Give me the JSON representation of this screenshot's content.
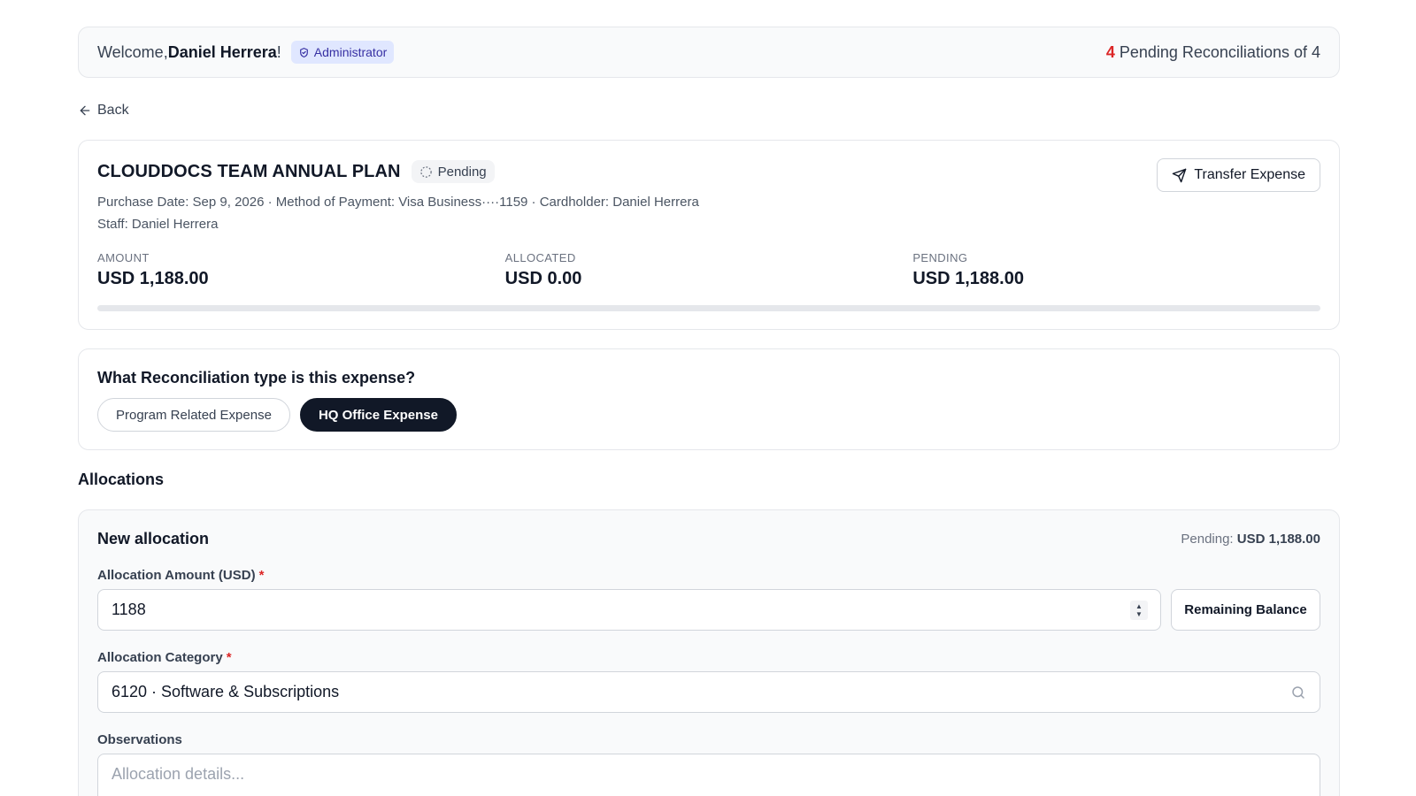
{
  "header": {
    "welcome_prefix": "Welcome, ",
    "user_name": "Daniel Herrera",
    "welcome_suffix": "!",
    "role_badge": "Administrator",
    "pending_count": "4",
    "pending_text": "Pending Reconciliations of 4"
  },
  "nav": {
    "back_label": "Back"
  },
  "expense": {
    "title": "CLOUDDOCS TEAM ANNUAL PLAN",
    "status": "Pending",
    "transfer_label": "Transfer Expense",
    "meta_line1": "Purchase Date: Sep 9, 2026 · Method of Payment: Visa Business····1159 · Cardholder: Daniel Herrera",
    "meta_line2": "Staff: Daniel Herrera",
    "amount_label": "AMOUNT",
    "amount_value": "USD 1,188.00",
    "allocated_label": "ALLOCATED",
    "allocated_value": "USD 0.00",
    "pending_label": "PENDING",
    "pending_value": "USD 1,188.00",
    "allocated_fraction": 0
  },
  "reconciliation": {
    "question": "What Reconciliation type is this expense?",
    "options": [
      "Program Related Expense",
      "HQ Office Expense"
    ],
    "selected": "HQ Office Expense"
  },
  "allocations": {
    "heading": "Allocations",
    "new_title": "New allocation",
    "pending_prefix": "Pending: ",
    "pending_value": "USD 1,188.00",
    "amount_label": "Allocation Amount (USD)",
    "amount_value": "1188",
    "remaining_label": "Remaining Balance",
    "category_label": "Allocation Category",
    "category_value": "6120 · Software & Subscriptions",
    "observations_label": "Observations",
    "observations_placeholder": "Allocation details...",
    "required_mark": "*"
  },
  "colors": {
    "accent_dark": "#111827",
    "danger": "#dc2626",
    "badge_bg": "#e0e7ff"
  }
}
